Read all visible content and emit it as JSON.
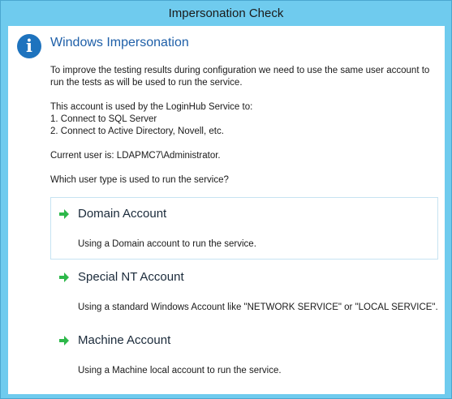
{
  "window": {
    "title": "Impersonation Check"
  },
  "header": {
    "icon": "info-icon",
    "icon_glyph": "i",
    "title": "Windows Impersonation"
  },
  "body": {
    "intro": "To improve the testing results during configuration we need to use the same user account to run the tests as will be used to run the service.",
    "uses_intro": "This account is used by the LoginHub Service to:",
    "uses": [
      "1. Connect to SQL Server",
      "2. Connect to Active Directory, Novell, etc."
    ],
    "current_user": "Current user is: LDAPMC7\\Administrator.",
    "question": "Which user type is used to run the service?"
  },
  "options": [
    {
      "icon": "green-arrow-icon",
      "title": "Domain Account",
      "description": "Using a Domain account to run the service.",
      "selected": true
    },
    {
      "icon": "green-arrow-icon",
      "title": "Special NT Account",
      "description": "Using a standard Windows Account like \"NETWORK SERVICE\" or \"LOCAL SERVICE\".",
      "selected": false
    },
    {
      "icon": "green-arrow-icon",
      "title": "Machine Account",
      "description": "Using a Machine local account to run the service.",
      "selected": false
    }
  ],
  "colors": {
    "frame": "#6fcbee",
    "heading": "#1e5fa8",
    "info_icon": "#1e73be",
    "arrow": "#2db84a",
    "selected_border": "#c7e3f2"
  }
}
